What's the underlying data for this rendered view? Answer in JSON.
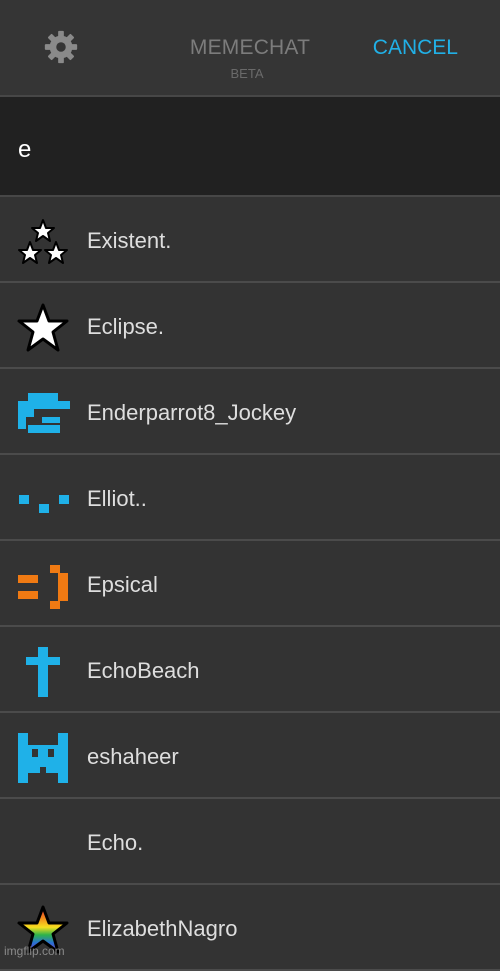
{
  "header": {
    "app_title": "MEMECHAT",
    "app_subtitle": "BETA",
    "cancel_label": "CANCEL",
    "settings_icon": "gear-icon",
    "accent_color": "#21b0e6"
  },
  "search": {
    "value": "e"
  },
  "results": [
    {
      "name": "Existent.",
      "avatar": "three-stars-icon"
    },
    {
      "name": "Eclipse.",
      "avatar": "white-star-icon"
    },
    {
      "name": "Enderparrot8_Jockey",
      "avatar": "blue-pixel-s-icon"
    },
    {
      "name": "Elliot..",
      "avatar": "blue-dots-face-icon"
    },
    {
      "name": "Epsical",
      "avatar": "orange-pixel-smile-icon"
    },
    {
      "name": "EchoBeach",
      "avatar": "blue-cross-icon"
    },
    {
      "name": "eshaheer",
      "avatar": "blue-pixel-creature-icon"
    },
    {
      "name": "Echo.",
      "avatar": ""
    },
    {
      "name": "ElizabethNagro",
      "avatar": "rainbow-star-icon"
    }
  ],
  "watermark": "imgflip.com"
}
